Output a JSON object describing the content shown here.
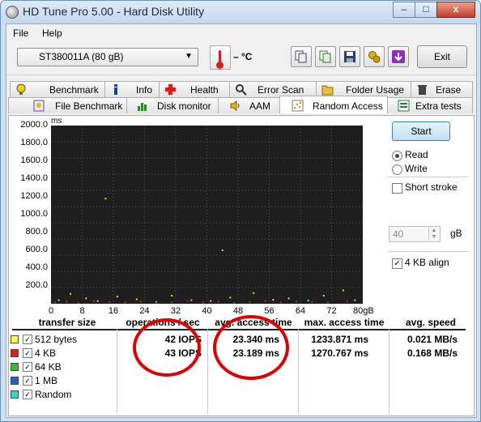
{
  "window": {
    "title": "HD Tune Pro 5.00 - Hard Disk Utility",
    "min": "–",
    "max": "□",
    "close": "x"
  },
  "menu": {
    "file": "File",
    "help": "Help"
  },
  "toolbar": {
    "drive": "ST380011A (80 gB)",
    "temperature": "– °C",
    "exit": "Exit"
  },
  "tabs_top": [
    "Benchmark",
    "Info",
    "Health",
    "Error Scan",
    "Folder Usage",
    "Erase"
  ],
  "tabs_bottom": [
    "File Benchmark",
    "Disk monitor",
    "AAM",
    "Random Access",
    "Extra tests"
  ],
  "active_tab": "Random Access",
  "controls": {
    "start": "Start",
    "read": "Read",
    "write": "Write",
    "short_stroke": "Short stroke",
    "short_stroke_value": "40",
    "short_stroke_unit": "gB",
    "align": "4 KB align"
  },
  "chart_data": {
    "type": "scatter",
    "ylabel": "ms",
    "y_ticks": [
      "2000.0",
      "1800.0",
      "1600.0",
      "1400.0",
      "1200.0",
      "1000.0",
      "800.0",
      "600.0",
      "400.0",
      "200.0"
    ],
    "x_ticks": [
      "0",
      "8",
      "16",
      "24",
      "32",
      "40",
      "48",
      "56",
      "64",
      "72",
      "80gB"
    ],
    "ylim": [
      0,
      2000
    ],
    "xlim": [
      0,
      80
    ],
    "grid": true,
    "series": [
      {
        "name": "512 bytes",
        "color": "#e8e800",
        "x": [
          2,
          5,
          9,
          12,
          17,
          22,
          27,
          31,
          36,
          41,
          46,
          52,
          57,
          61,
          66,
          70,
          75,
          78,
          14,
          44
        ],
        "y": [
          40,
          110,
          60,
          30,
          80,
          50,
          20,
          90,
          40,
          30,
          70,
          120,
          45,
          60,
          35,
          90,
          150,
          40,
          1180,
          600
        ]
      },
      {
        "name": "4 KB",
        "color": "#d82020",
        "x": [
          1,
          4,
          7,
          11,
          15,
          19,
          23,
          27,
          31,
          35,
          39,
          43,
          47,
          51,
          55,
          59,
          63,
          67,
          71,
          76
        ],
        "y": [
          15,
          25,
          10,
          30,
          20,
          15,
          25,
          10,
          20,
          30,
          15,
          25,
          10,
          20,
          30,
          15,
          25,
          20,
          15,
          25
        ]
      }
    ]
  },
  "results": {
    "headers": [
      "transfer size",
      "operations / sec",
      "avg. access time",
      "max. access time",
      "avg. speed"
    ],
    "rows": [
      {
        "label": "512 bytes",
        "color": "#ffff40",
        "checked": true,
        "ops": "42 IOPS",
        "avg": "23.340 ms",
        "max": "1233.871 ms",
        "speed": "0.021 MB/s"
      },
      {
        "label": "4 KB",
        "color": "#e02020",
        "checked": true,
        "ops": "43 IOPS",
        "avg": "23.189 ms",
        "max": "1270.767 ms",
        "speed": "0.168 MB/s"
      },
      {
        "label": "64 KB",
        "color": "#30c030",
        "checked": true,
        "ops": "",
        "avg": "",
        "max": "",
        "speed": ""
      },
      {
        "label": "1 MB",
        "color": "#2060d0",
        "checked": true,
        "ops": "",
        "avg": "",
        "max": "",
        "speed": ""
      },
      {
        "label": "Random",
        "color": "#30d8d8",
        "checked": true,
        "ops": "",
        "avg": "",
        "max": "",
        "speed": ""
      }
    ]
  },
  "check_glyph": "✓"
}
